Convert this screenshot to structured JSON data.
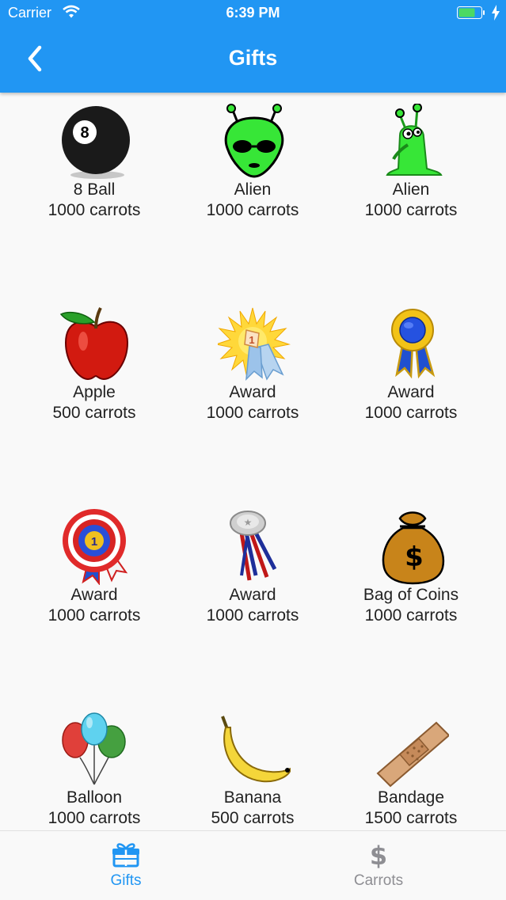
{
  "status_bar": {
    "carrier": "Carrier",
    "time": "6:39 PM"
  },
  "app_bar": {
    "title": "Gifts"
  },
  "gifts": [
    {
      "name": "8 Ball",
      "price": "1000 carrots",
      "icon": "eight-ball-icon"
    },
    {
      "name": "Alien",
      "price": "1000 carrots",
      "icon": "alien-head-icon"
    },
    {
      "name": "Alien",
      "price": "1000 carrots",
      "icon": "alien-creature-icon"
    },
    {
      "name": "Apple",
      "price": "500 carrots",
      "icon": "apple-icon"
    },
    {
      "name": "Award",
      "price": "1000 carrots",
      "icon": "award-sunburst-icon"
    },
    {
      "name": "Award",
      "price": "1000 carrots",
      "icon": "award-ribbon-icon"
    },
    {
      "name": "Award",
      "price": "1000 carrots",
      "icon": "award-rosette-icon"
    },
    {
      "name": "Award",
      "price": "1000 carrots",
      "icon": "award-medal-icon"
    },
    {
      "name": "Bag of Coins",
      "price": "1000 carrots",
      "icon": "money-bag-icon"
    },
    {
      "name": "Balloon",
      "price": "1000 carrots",
      "icon": "balloons-icon"
    },
    {
      "name": "Banana",
      "price": "500 carrots",
      "icon": "banana-icon"
    },
    {
      "name": "Bandage",
      "price": "1500 carrots",
      "icon": "bandage-icon"
    }
  ],
  "tabs": [
    {
      "label": "Gifts",
      "icon": "gift-icon",
      "active": true
    },
    {
      "label": "Carrots",
      "icon": "dollar-icon",
      "active": false
    }
  ],
  "colors": {
    "primary": "#2196f3",
    "tab_active": "#2196f3",
    "tab_inactive": "#8e8e93",
    "battery": "#4cd964"
  }
}
